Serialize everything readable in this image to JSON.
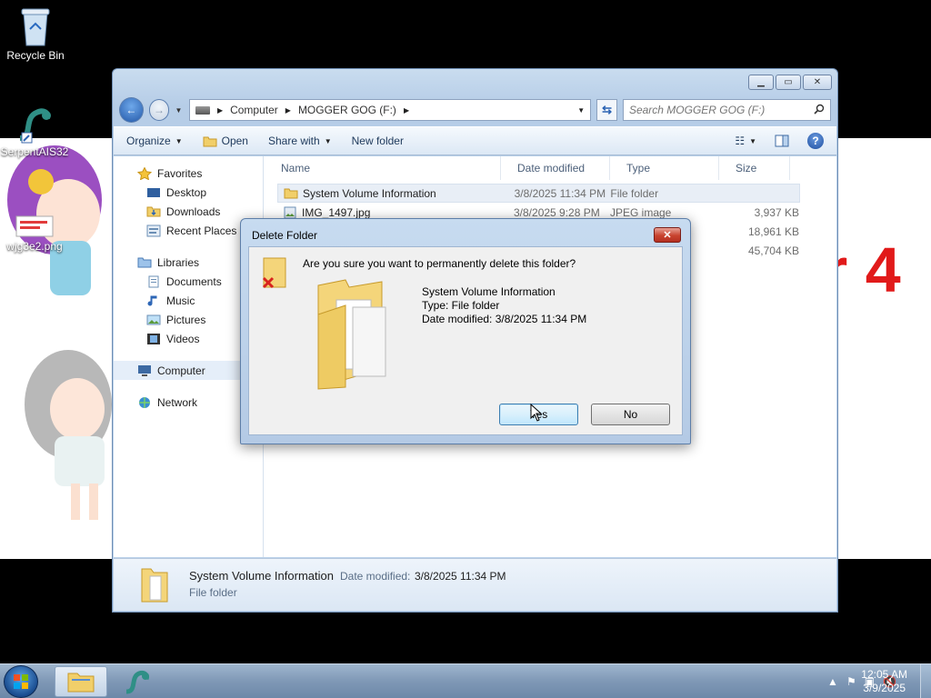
{
  "desktop": {
    "icons": [
      {
        "label": "Recycle Bin",
        "icon": "recycle-bin-icon"
      },
      {
        "label": "SerpentAIS32",
        "icon": "serpent-icon"
      },
      {
        "label": "wjg3e2.png",
        "icon": "image-file-icon"
      }
    ],
    "wallpaper_text": "r 4"
  },
  "explorer": {
    "breadcrumb": [
      "Computer",
      "MOGGER GOG (F:)"
    ],
    "search_placeholder": "Search MOGGER GOG (F:)",
    "toolbar": {
      "organize": "Organize",
      "open": "Open",
      "share_with": "Share with",
      "new_folder": "New folder"
    },
    "nav": {
      "favorites": {
        "label": "Favorites",
        "items": [
          "Desktop",
          "Downloads",
          "Recent Places"
        ]
      },
      "libraries": {
        "label": "Libraries",
        "items": [
          "Documents",
          "Music",
          "Pictures",
          "Videos"
        ]
      },
      "computer": "Computer",
      "network": "Network"
    },
    "columns": [
      "Name",
      "Date modified",
      "Type",
      "Size"
    ],
    "files": [
      {
        "name": "System Volume Information",
        "date": "3/8/2025 11:34 PM",
        "type": "File folder",
        "size": ""
      },
      {
        "name": "IMG_1497.jpg",
        "date": "3/8/2025 9:28 PM",
        "type": "JPEG image",
        "size": "3,937 KB"
      },
      {
        "name": "",
        "date": "",
        "type": "",
        "size": "18,961 KB"
      },
      {
        "name": "",
        "date": "",
        "type": "",
        "size": "45,704 KB"
      }
    ],
    "details": {
      "name": "System Volume Information",
      "date_label": "Date modified:",
      "date_value": "3/8/2025 11:34 PM",
      "type": "File folder"
    }
  },
  "dialog": {
    "title": "Delete Folder",
    "question": "Are you sure you want to permanently delete this folder?",
    "item_name": "System Volume Information",
    "item_type": "Type: File folder",
    "item_date": "Date modified: 3/8/2025 11:34 PM",
    "yes_label": "Yes",
    "no_label": "No",
    "close_glyph": "✕"
  },
  "taskbar": {
    "time": "12:05 AM",
    "date": "3/9/2025"
  },
  "colors": {
    "accent": "#2b63b3",
    "wallpaper_text": "#e11a1a",
    "close_button": "#c8432f"
  }
}
